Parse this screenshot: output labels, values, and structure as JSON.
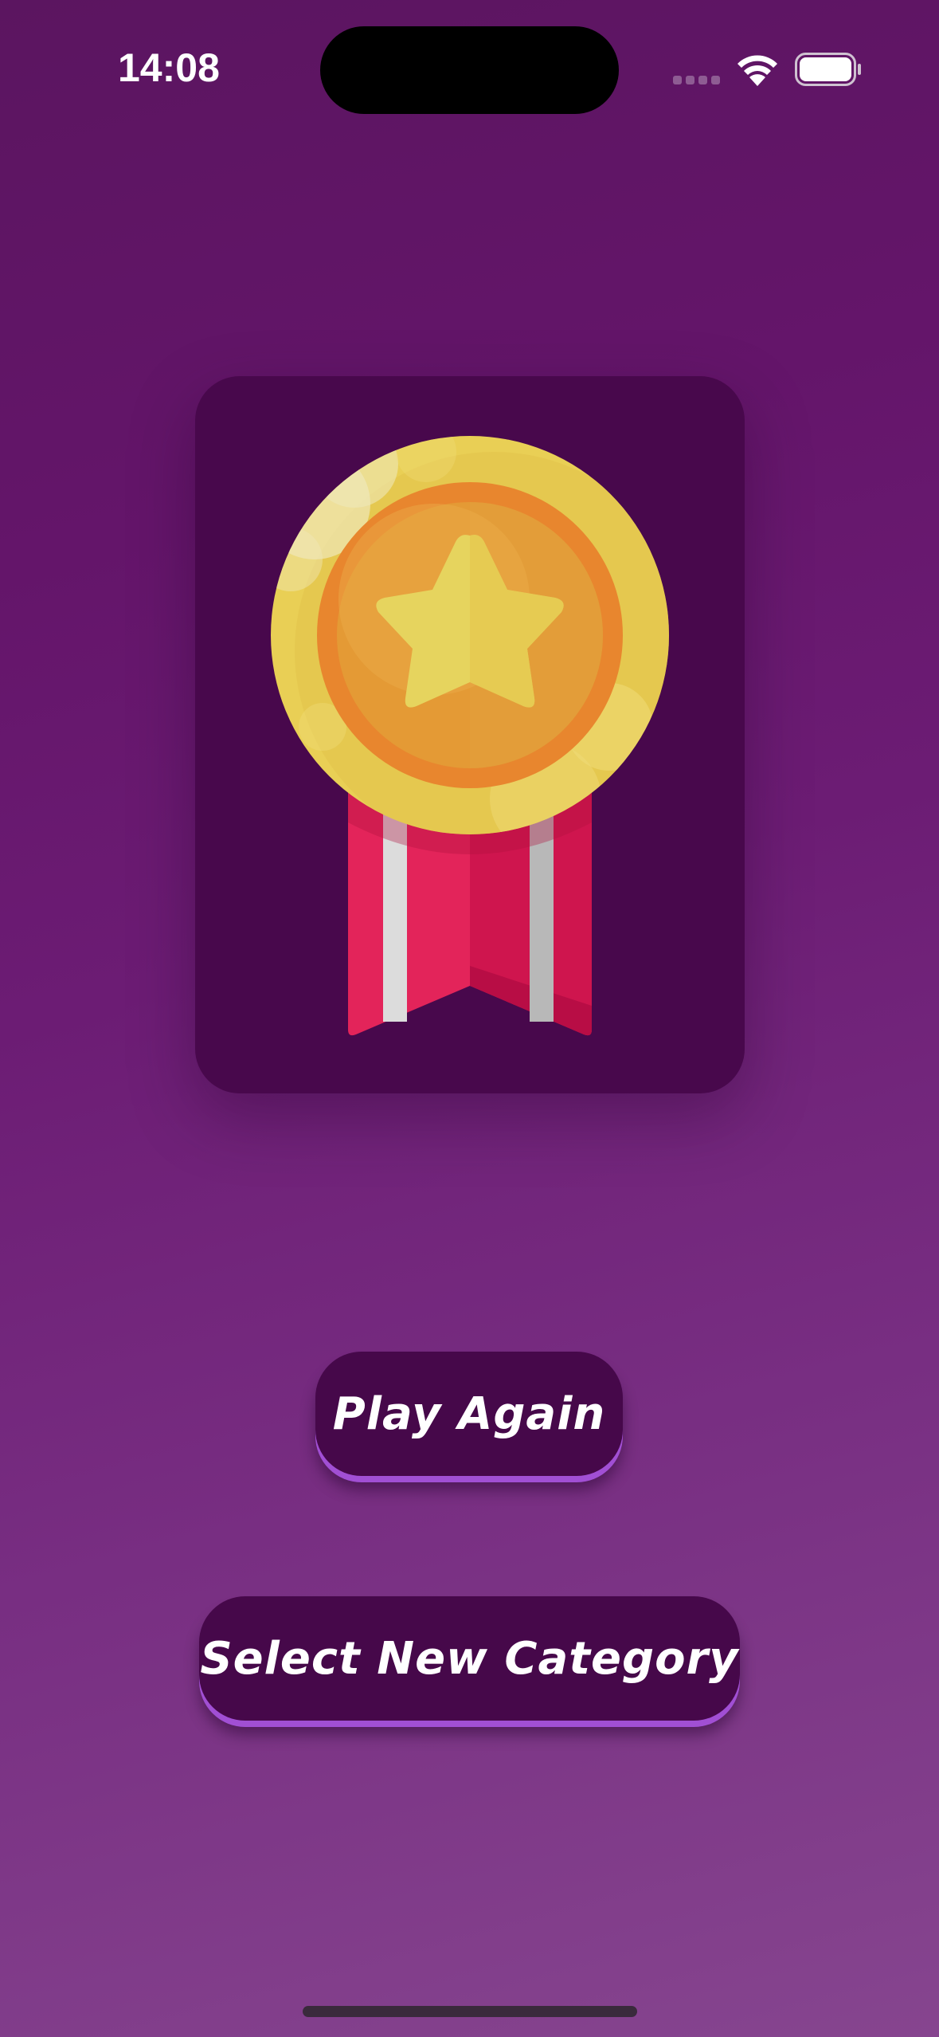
{
  "status_bar": {
    "time": "14:08"
  },
  "result_card": {
    "icon": "medal-icon",
    "colors": {
      "card": "#48084c",
      "coin": "#e9cf55",
      "coin_inner": "#e49a35",
      "star": "#e6d45e",
      "ribbon": "#e3245a"
    }
  },
  "actions": {
    "play_again_label": "Play Again",
    "select_category_label": "Select New Category"
  },
  "theme": {
    "background_top": "#5b1560",
    "background_bottom": "#86458f",
    "button": "#46084a",
    "button_edge": "#a14fd4"
  }
}
